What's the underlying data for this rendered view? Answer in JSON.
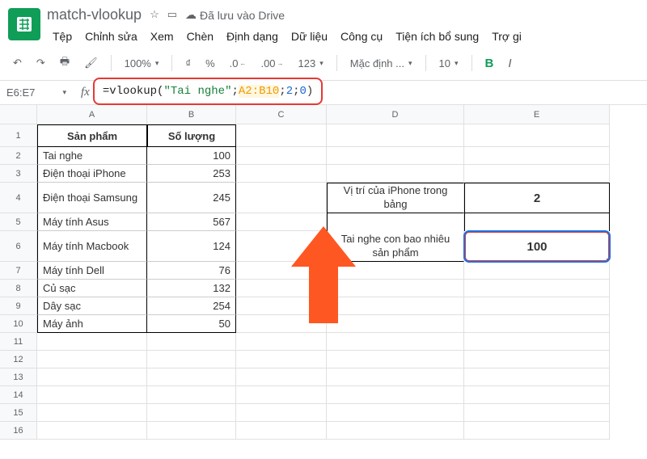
{
  "title": "match-vlookup",
  "saved_label": "Đã lưu vào Drive",
  "menu": {
    "file": "Tệp",
    "edit": "Chỉnh sửa",
    "view": "Xem",
    "insert": "Chèn",
    "format": "Định dạng",
    "data": "Dữ liệu",
    "tools": "Công cụ",
    "addons": "Tiện ích bổ sung",
    "help": "Trợ gi"
  },
  "toolbar": {
    "zoom": "100%",
    "currency": "₫",
    "percent": "%",
    "dec_dec": ".0",
    "dec_inc": ".00",
    "num_fmt": "123",
    "font": "Mặc định ...",
    "size": "10",
    "bold": "B",
    "italic": "I"
  },
  "namebox": "E6:E7",
  "formula": {
    "eq": "=",
    "fn": "vlookup(",
    "arg1": "\"Tai nghe\"",
    "sep1": ";",
    "arg2": "A2:B10",
    "sep2": ";",
    "arg3": "2",
    "sep3": ";",
    "arg4": "0",
    "close": ")"
  },
  "cols": [
    "A",
    "B",
    "C",
    "D",
    "E"
  ],
  "headers": {
    "a": "Sản phẩm",
    "b": "Số lượng"
  },
  "rows": [
    {
      "a": "Tai nghe",
      "b": "100"
    },
    {
      "a": "Điện thoại iPhone",
      "b": "253"
    },
    {
      "a": "Điện thoại Samsung",
      "b": "245"
    },
    {
      "a": "Máy tính Asus",
      "b": "567"
    },
    {
      "a": "Máy tính Macbook",
      "b": "124"
    },
    {
      "a": "Máy tính Dell",
      "b": "76"
    },
    {
      "a": "Củ sạc",
      "b": "132"
    },
    {
      "a": "Dây sạc",
      "b": "254"
    },
    {
      "a": "Máy ảnh",
      "b": "50"
    }
  ],
  "lookup_box": {
    "label1": "Vị trí của iPhone trong bảng",
    "val1": "2",
    "label2": "Tai nghe con bao nhiêu sản phẩm",
    "val2": "100"
  },
  "chart_data": {
    "type": "table",
    "title": "Sản phẩm / Số lượng",
    "columns": [
      "Sản phẩm",
      "Số lượng"
    ],
    "rows": [
      [
        "Tai nghe",
        100
      ],
      [
        "Điện thoại iPhone",
        253
      ],
      [
        "Điện thoại Samsung",
        245
      ],
      [
        "Máy tính Asus",
        567
      ],
      [
        "Máy tính Macbook",
        124
      ],
      [
        "Máy tính Dell",
        76
      ],
      [
        "Củ sạc",
        132
      ],
      [
        "Dây sạc",
        254
      ],
      [
        "Máy ảnh",
        50
      ]
    ]
  }
}
